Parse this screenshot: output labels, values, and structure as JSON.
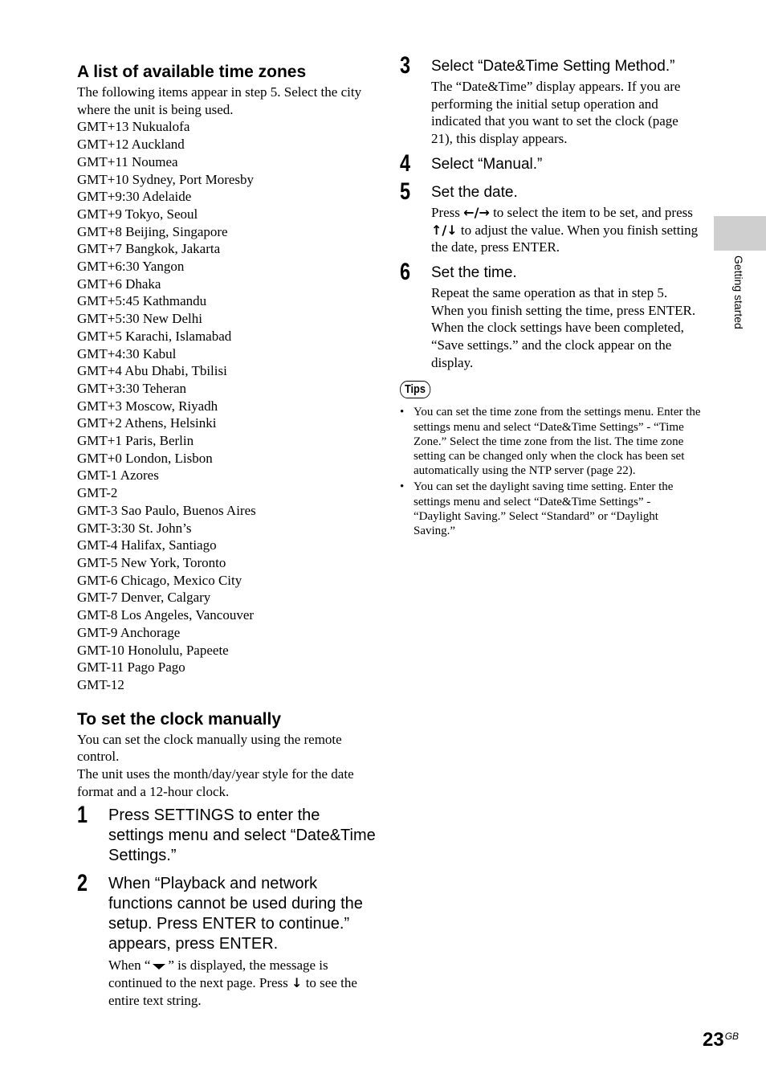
{
  "time_zones_section": {
    "heading": "A list of available time zones",
    "intro": "The following items appear in step 5. Select the city where the unit is being used.",
    "zones": [
      "GMT+13 Nukualofa",
      "GMT+12 Auckland",
      "GMT+11 Noumea",
      "GMT+10 Sydney, Port Moresby",
      "GMT+9:30 Adelaide",
      "GMT+9 Tokyo, Seoul",
      "GMT+8 Beijing, Singapore",
      "GMT+7 Bangkok, Jakarta",
      "GMT+6:30 Yangon",
      "GMT+6 Dhaka",
      "GMT+5:45 Kathmandu",
      "GMT+5:30 New Delhi",
      "GMT+5 Karachi, Islamabad",
      "GMT+4:30 Kabul",
      "GMT+4 Abu Dhabi, Tbilisi",
      "GMT+3:30 Teheran",
      "GMT+3 Moscow, Riyadh",
      "GMT+2 Athens, Helsinki",
      "GMT+1 Paris, Berlin",
      "GMT+0 London, Lisbon",
      "GMT-1 Azores",
      "GMT-2",
      "GMT-3 Sao Paulo, Buenos Aires",
      "GMT-3:30 St. John’s",
      "GMT-4 Halifax, Santiago",
      "GMT-5 New York, Toronto",
      "GMT-6 Chicago, Mexico City",
      "GMT-7 Denver, Calgary",
      "GMT-8 Los Angeles, Vancouver",
      "GMT-9 Anchorage",
      "GMT-10 Honolulu, Papeete",
      "GMT-11 Pago Pago",
      "GMT-12"
    ]
  },
  "manual_clock_section": {
    "heading": "To set the clock manually",
    "intro_1": "You can set the clock manually using the remote control.",
    "intro_2": "The unit uses the month/day/year style for the date format and a 12-hour clock."
  },
  "steps": [
    {
      "number": "1",
      "title": "Press SETTINGS to enter the settings menu and select “Date&Time Settings.”"
    },
    {
      "number": "2",
      "title": "When “Playback and network functions cannot be used during the setup. Press ENTER to continue.” appears, press ENTER.",
      "body_before_icon": "When “",
      "body_after_icon": "” is displayed, the message is continued to the next page. Press ",
      "body_end": " to see the entire text string."
    },
    {
      "number": "3",
      "title": "Select “Date&Time Setting Method.”",
      "body": "The “Date&Time” display appears. If you are performing the initial setup operation and indicated that you want to set the clock (page 21), this display appears."
    },
    {
      "number": "4",
      "title": "Select “Manual.”"
    },
    {
      "number": "5",
      "title": "Set the date.",
      "body_1": "Press ",
      "body_2": " to select the item to be set, and press ",
      "body_3": " to adjust the value. When you finish setting the date, press ENTER."
    },
    {
      "number": "6",
      "title": "Set the time.",
      "body_1": "Repeat the same operation as that in step 5. When you finish setting the time, press ENTER.",
      "body_2": "When the clock settings have been completed, “Save settings.” and the clock appear on the display."
    }
  ],
  "icons": {
    "left_right": "←/→",
    "up_down": "↑/↓",
    "down": "↓"
  },
  "tips": {
    "label": "Tips",
    "items": [
      "You can set the time zone from the settings menu. Enter the settings menu and select “Date&Time Settings” - “Time Zone.” Select the time zone from the list. The time zone setting can be changed only when the clock has been set automatically using the NTP server (page 22).",
      "You can set the daylight saving time setting. Enter the settings menu and select “Date&Time Settings” - “Daylight Saving.” Select “Standard” or “Daylight Saving.”"
    ]
  },
  "side_tab": {
    "label": "Getting started",
    "color": "#cfcfcf"
  },
  "page_number": {
    "number": "23",
    "suffix": "GB"
  }
}
